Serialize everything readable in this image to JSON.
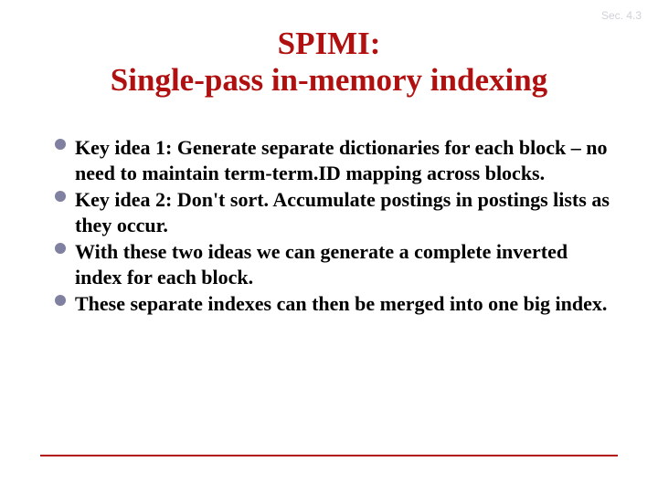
{
  "section_label": "Sec. 4.3",
  "title_line1": "SPIMI:",
  "title_line2": "Single-pass in-memory indexing",
  "bullets": [
    "Key idea 1: Generate separate dictionaries for each block – no need to maintain term-term.ID mapping across blocks.",
    "Key idea 2: Don't sort. Accumulate postings in postings lists as they occur.",
    "With these two ideas we can generate a complete inverted index for each block.",
    "These separate indexes can then be merged into one big index."
  ]
}
